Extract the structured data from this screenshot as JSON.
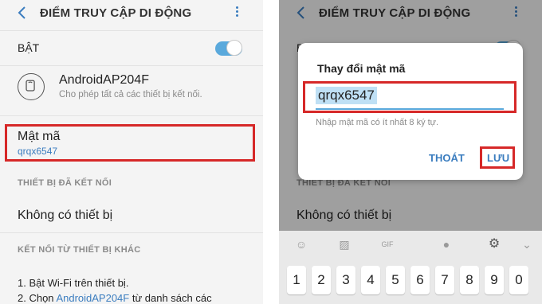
{
  "left": {
    "header": {
      "title": "ĐIỂM TRUY CẬP DI ĐỘNG"
    },
    "toggle_row": {
      "label": "BẬT"
    },
    "ap": {
      "name": "AndroidAP204F",
      "desc": "Cho phép tất cả các thiết bị kết nối."
    },
    "password": {
      "label": "Mật mã",
      "value": "qrqx6547"
    },
    "connected_section": "THIẾT BỊ ĐÃ KẾT NỐI",
    "no_device": "Không có thiết bị",
    "other_section": "KẾT NỐI TỪ THIẾT BỊ KHÁC",
    "step1": "1. Bật Wi-Fi trên thiết bị.",
    "step2_prefix": "2. Chọn ",
    "step2_link": "AndroidAP204F",
    "step2_suffix": " từ danh sách các"
  },
  "right": {
    "header": {
      "title": "ĐIỂM TRUY CẬP DI ĐỘNG"
    },
    "bg_toggle_label": "Bậ",
    "bg_section": "THIẾT BỊ ĐÃ KẾT NỐI",
    "bg_no_device": "Không có thiết bị",
    "dialog": {
      "title": "Thay đổi mật mã",
      "input_value": "qrqx6547",
      "hint": "Nhập mật mã có ít nhất 8 ký tự.",
      "cancel": "THOÁT",
      "save": "LƯU"
    },
    "keyboard": {
      "toolbar_icons": [
        "emoji-icon",
        "sticker-icon",
        "gif-icon",
        "mic-icon",
        "gear-icon",
        "chevron-down-icon"
      ],
      "keys": [
        "1",
        "2",
        "3",
        "4",
        "5",
        "6",
        "7",
        "8",
        "9",
        "0"
      ]
    }
  },
  "colors": {
    "accent": "#3b7dbf",
    "highlight": "#d62828",
    "toggle": "#5aa9dc"
  }
}
